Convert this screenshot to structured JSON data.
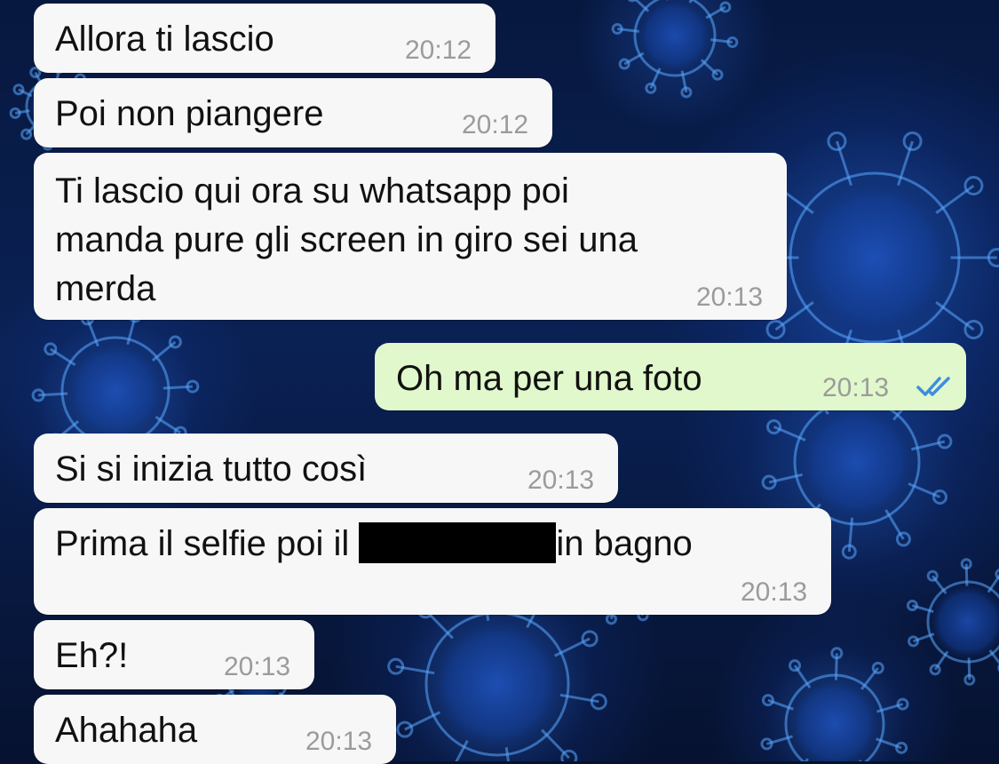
{
  "conversation": {
    "messages": [
      {
        "direction": "incoming",
        "text": "Allora ti lascio",
        "time": "20:12"
      },
      {
        "direction": "incoming",
        "text": "Poi non piangere",
        "time": "20:12"
      },
      {
        "direction": "incoming",
        "lines": [
          "Ti lascio qui ora su whatsapp poi",
          "manda pure gli screen in giro sei una",
          "merda"
        ],
        "time": "20:13"
      },
      {
        "direction": "outgoing",
        "text": "Oh ma per una foto",
        "time": "20:13",
        "status": "read",
        "status_icon": "double-check-icon"
      },
      {
        "direction": "incoming",
        "text": "Si si inizia tutto così",
        "time": "20:13"
      },
      {
        "direction": "incoming",
        "text_before": "Prima il selfie poi il ",
        "redacted": true,
        "text_after": "in bagno",
        "time": "20:13"
      },
      {
        "direction": "incoming",
        "text": "Eh?!",
        "time": "20:13"
      },
      {
        "direction": "incoming",
        "text": "Ahahaha",
        "time": "20:13"
      }
    ]
  },
  "theme": {
    "incoming_bubble": "#f7f7f7",
    "outgoing_bubble": "#e0f8cb",
    "text_color": "#111111",
    "time_color": "#9b9b9b",
    "read_tick_color": "#3d8de0",
    "wallpaper": "blue virus wallpaper on dark navy"
  }
}
